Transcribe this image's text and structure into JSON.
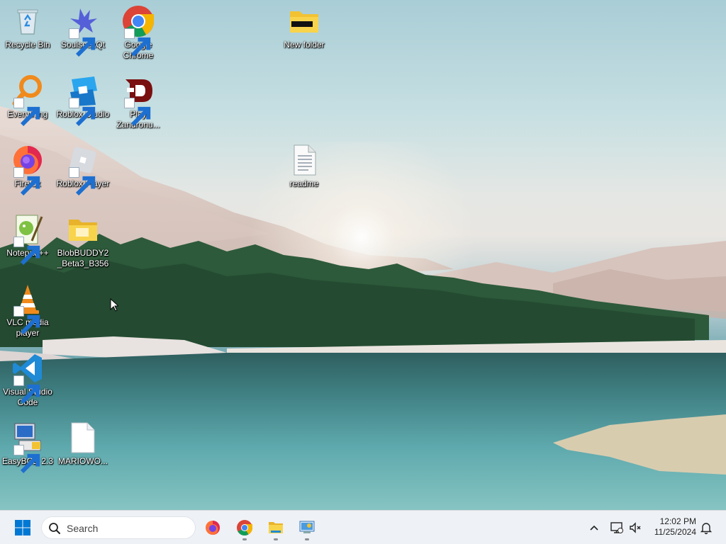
{
  "desktop": {
    "icons": [
      {
        "id": "recycle-bin",
        "label": "Recycle Bin"
      },
      {
        "id": "soulseekqt",
        "label": "SoulseekQt"
      },
      {
        "id": "google-chrome",
        "label": "Google Chrome"
      },
      {
        "id": "new-folder",
        "label": "New folder"
      },
      {
        "id": "everything",
        "label": "Everything"
      },
      {
        "id": "roblox-studio",
        "label": "Roblox Studio"
      },
      {
        "id": "play-zandronum",
        "label": "Play Zandronu..."
      },
      {
        "id": "firefox",
        "label": "Firefox"
      },
      {
        "id": "roblox-player",
        "label": "Roblox Player"
      },
      {
        "id": "readme",
        "label": "readme"
      },
      {
        "id": "notepad-plus-plus",
        "label": "Notepad++"
      },
      {
        "id": "blobbuddy",
        "label": "BlobBUDDY2_Beta3_B356"
      },
      {
        "id": "vlc",
        "label": "VLC media player"
      },
      {
        "id": "vscode",
        "label": "Visual Studio Code"
      },
      {
        "id": "easybcd",
        "label": "EasyBCD 2.3"
      },
      {
        "id": "mariowo",
        "label": "MARIOWO..."
      }
    ]
  },
  "taskbar": {
    "search_placeholder": "Search",
    "pinned": [
      {
        "name": "firefox",
        "icon": "firefox-icon"
      },
      {
        "name": "chrome",
        "icon": "chrome-icon"
      },
      {
        "name": "file-explorer",
        "icon": "folder-icon"
      },
      {
        "name": "control-panel",
        "icon": "control-panel-icon"
      }
    ],
    "clock": {
      "time": "12:02 PM",
      "date": "11/25/2024"
    }
  },
  "colors": {
    "accent": "#0078d4",
    "taskbar_bg": "#eef1f5"
  }
}
